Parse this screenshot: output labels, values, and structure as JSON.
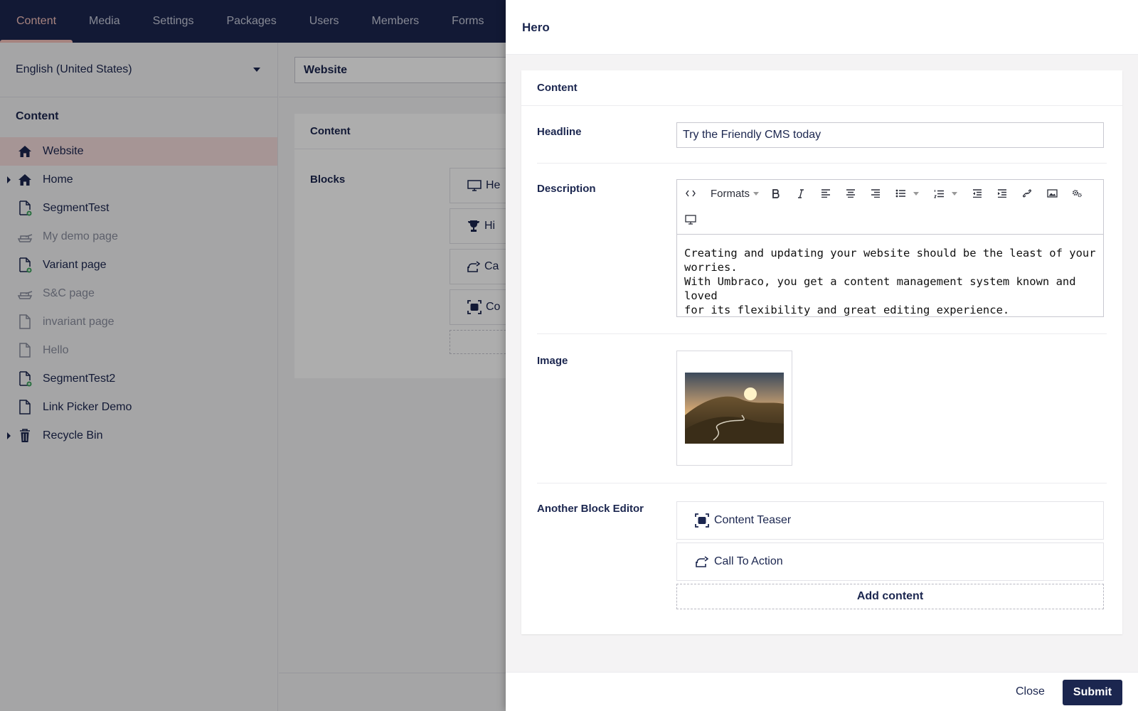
{
  "topnav": {
    "tabs": [
      {
        "label": "Content",
        "active": true
      },
      {
        "label": "Media"
      },
      {
        "label": "Settings"
      },
      {
        "label": "Packages"
      },
      {
        "label": "Users"
      },
      {
        "label": "Members"
      },
      {
        "label": "Forms"
      }
    ]
  },
  "tree": {
    "language": "English (United States)",
    "section_title": "Content",
    "items": [
      {
        "label": "Website",
        "icon": "home-icon",
        "selected": true
      },
      {
        "label": "Home",
        "icon": "home-icon",
        "expandable": true
      },
      {
        "label": "SegmentTest",
        "icon": "document-segment-icon"
      },
      {
        "label": "My demo page",
        "icon": "tank-icon",
        "muted": true
      },
      {
        "label": "Variant page",
        "icon": "document-segment-icon"
      },
      {
        "label": "S&C page",
        "icon": "tank-icon",
        "muted": true
      },
      {
        "label": "invariant page",
        "icon": "document-icon",
        "muted": true
      },
      {
        "label": "Hello",
        "icon": "document-icon",
        "muted": true
      },
      {
        "label": "SegmentTest2",
        "icon": "document-segment-icon"
      },
      {
        "label": "Link Picker Demo",
        "icon": "document-icon"
      },
      {
        "label": "Recycle Bin",
        "icon": "trash-icon",
        "expandable": true
      }
    ]
  },
  "editor": {
    "name": "Website",
    "group_title": "Content",
    "blocks_label": "Blocks",
    "block_stubs": [
      "He",
      "Hi",
      "Ca",
      "Co"
    ]
  },
  "dialog": {
    "title": "Hero",
    "group_title": "Content",
    "headline_label": "Headline",
    "headline_value": "Try the Friendly CMS today",
    "description_label": "Description",
    "formats_label": "Formats",
    "description_lines": [
      "Creating and updating your website should be the least of your worries.",
      "With Umbraco, you get a content management system known and loved",
      "for its flexibility and great editing experience."
    ],
    "image_label": "Image",
    "another_label": "Another Block Editor",
    "blocks": [
      {
        "label": "Content Teaser",
        "icon": "content-teaser-icon"
      },
      {
        "label": "Call To Action",
        "icon": "share-icon"
      }
    ],
    "add_content": "Add content",
    "close": "Close",
    "submit": "Submit"
  },
  "colors": {
    "brand": "#1b264f",
    "accent": "#f5c1bc",
    "selected_bg": "#f5dcdc"
  }
}
